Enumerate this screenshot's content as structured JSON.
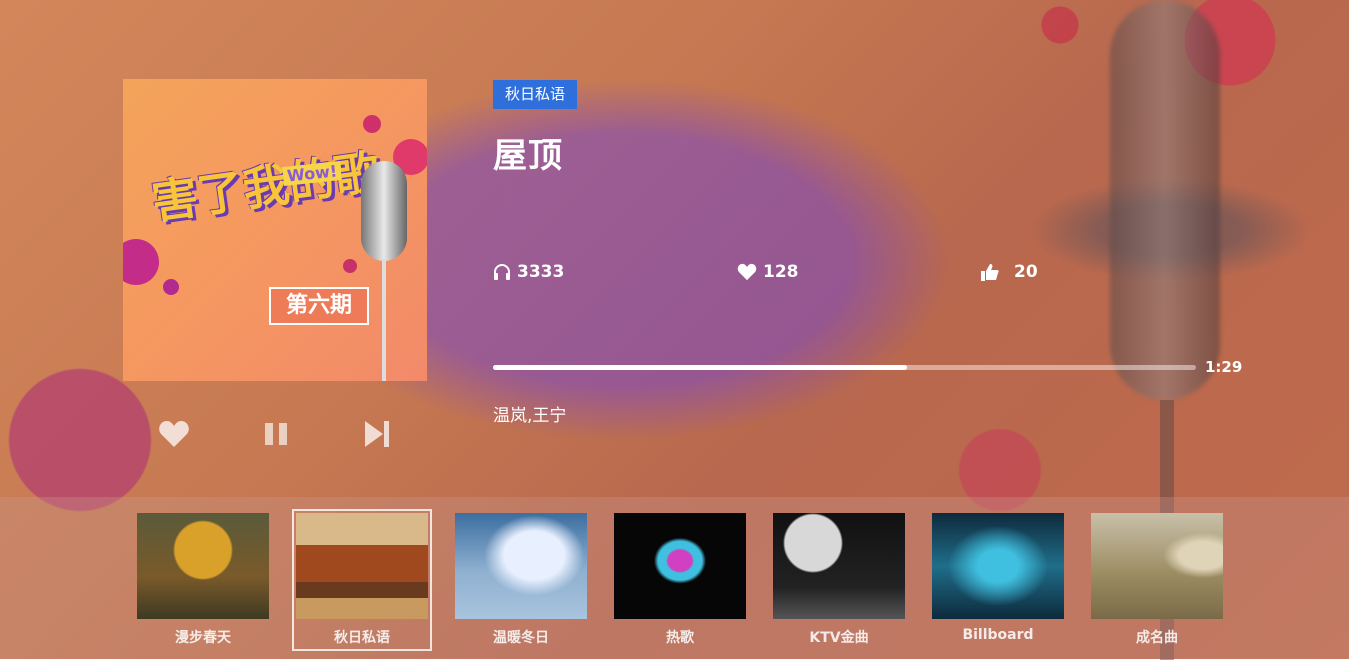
{
  "player": {
    "category_tag": "秋日私语",
    "song_title": "屋顶",
    "artist": "温岚,王宁",
    "listen_count": "3333",
    "like_count": "128",
    "thumbs_count": "20",
    "elapsed_time": "1:29",
    "progress_fraction": 0.589
  },
  "cover": {
    "title_text": "害了我的歌",
    "wow_text": "Wow!",
    "episode_badge": "第六期"
  },
  "controls": {
    "favorite_icon": "heart-icon",
    "pause_icon": "pause-icon",
    "next_icon": "skip-next-icon"
  },
  "playlists": [
    {
      "label": "漫步春天",
      "theme": "#8a6a2a",
      "active": false
    },
    {
      "label": "秋日私语",
      "theme": "#8e4a22",
      "active": true
    },
    {
      "label": "温暖冬日",
      "theme": "#5b7ea6",
      "active": false
    },
    {
      "label": "热歌",
      "theme": "#0d0d0d",
      "active": false
    },
    {
      "label": "KTV金曲",
      "theme": "#222222",
      "active": false
    },
    {
      "label": "Billboard",
      "theme": "#1f5e74",
      "active": false
    },
    {
      "label": "成名曲",
      "theme": "#9a8a64",
      "active": false
    }
  ],
  "colors": {
    "tag_blue": "#2f6fdc",
    "progress_fill": "#ffffff"
  }
}
